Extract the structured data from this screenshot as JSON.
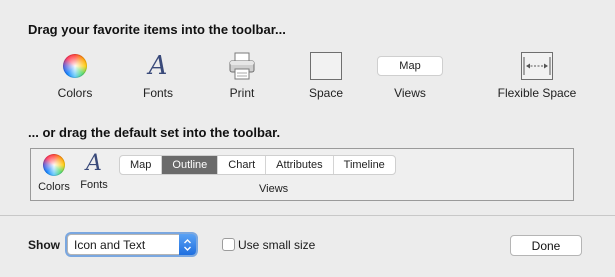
{
  "headings": {
    "favorites": "Drag your favorite items into the toolbar...",
    "default_set": "... or drag the default set into the toolbar."
  },
  "palette": {
    "colors": {
      "label": "Colors",
      "icon": "color-wheel-icon"
    },
    "fonts": {
      "label": "Fonts",
      "icon": "fonts-icon",
      "glyph": "A"
    },
    "print": {
      "label": "Print",
      "icon": "printer-icon"
    },
    "space": {
      "label": "Space",
      "icon": "space-icon"
    },
    "views": {
      "label": "Views",
      "segment_label": "Map"
    },
    "flexible_space": {
      "label": "Flexible Space",
      "icon": "flexible-space-icon"
    }
  },
  "default_set": {
    "colors_label": "Colors",
    "fonts_label": "Fonts",
    "fonts_glyph": "A",
    "views_label": "Views",
    "segments": [
      {
        "label": "Map",
        "selected": false
      },
      {
        "label": "Outline",
        "selected": true
      },
      {
        "label": "Chart",
        "selected": false
      },
      {
        "label": "Attributes",
        "selected": false
      },
      {
        "label": "Timeline",
        "selected": false
      }
    ]
  },
  "footer": {
    "show_label": "Show",
    "show_value": "Icon and Text",
    "small_size_label": "Use small size",
    "small_size_checked": false,
    "done_label": "Done"
  },
  "colors": {
    "selected_segment": "#6b6b6b",
    "select_accent": "#1f6fe0",
    "background": "#ececec"
  }
}
